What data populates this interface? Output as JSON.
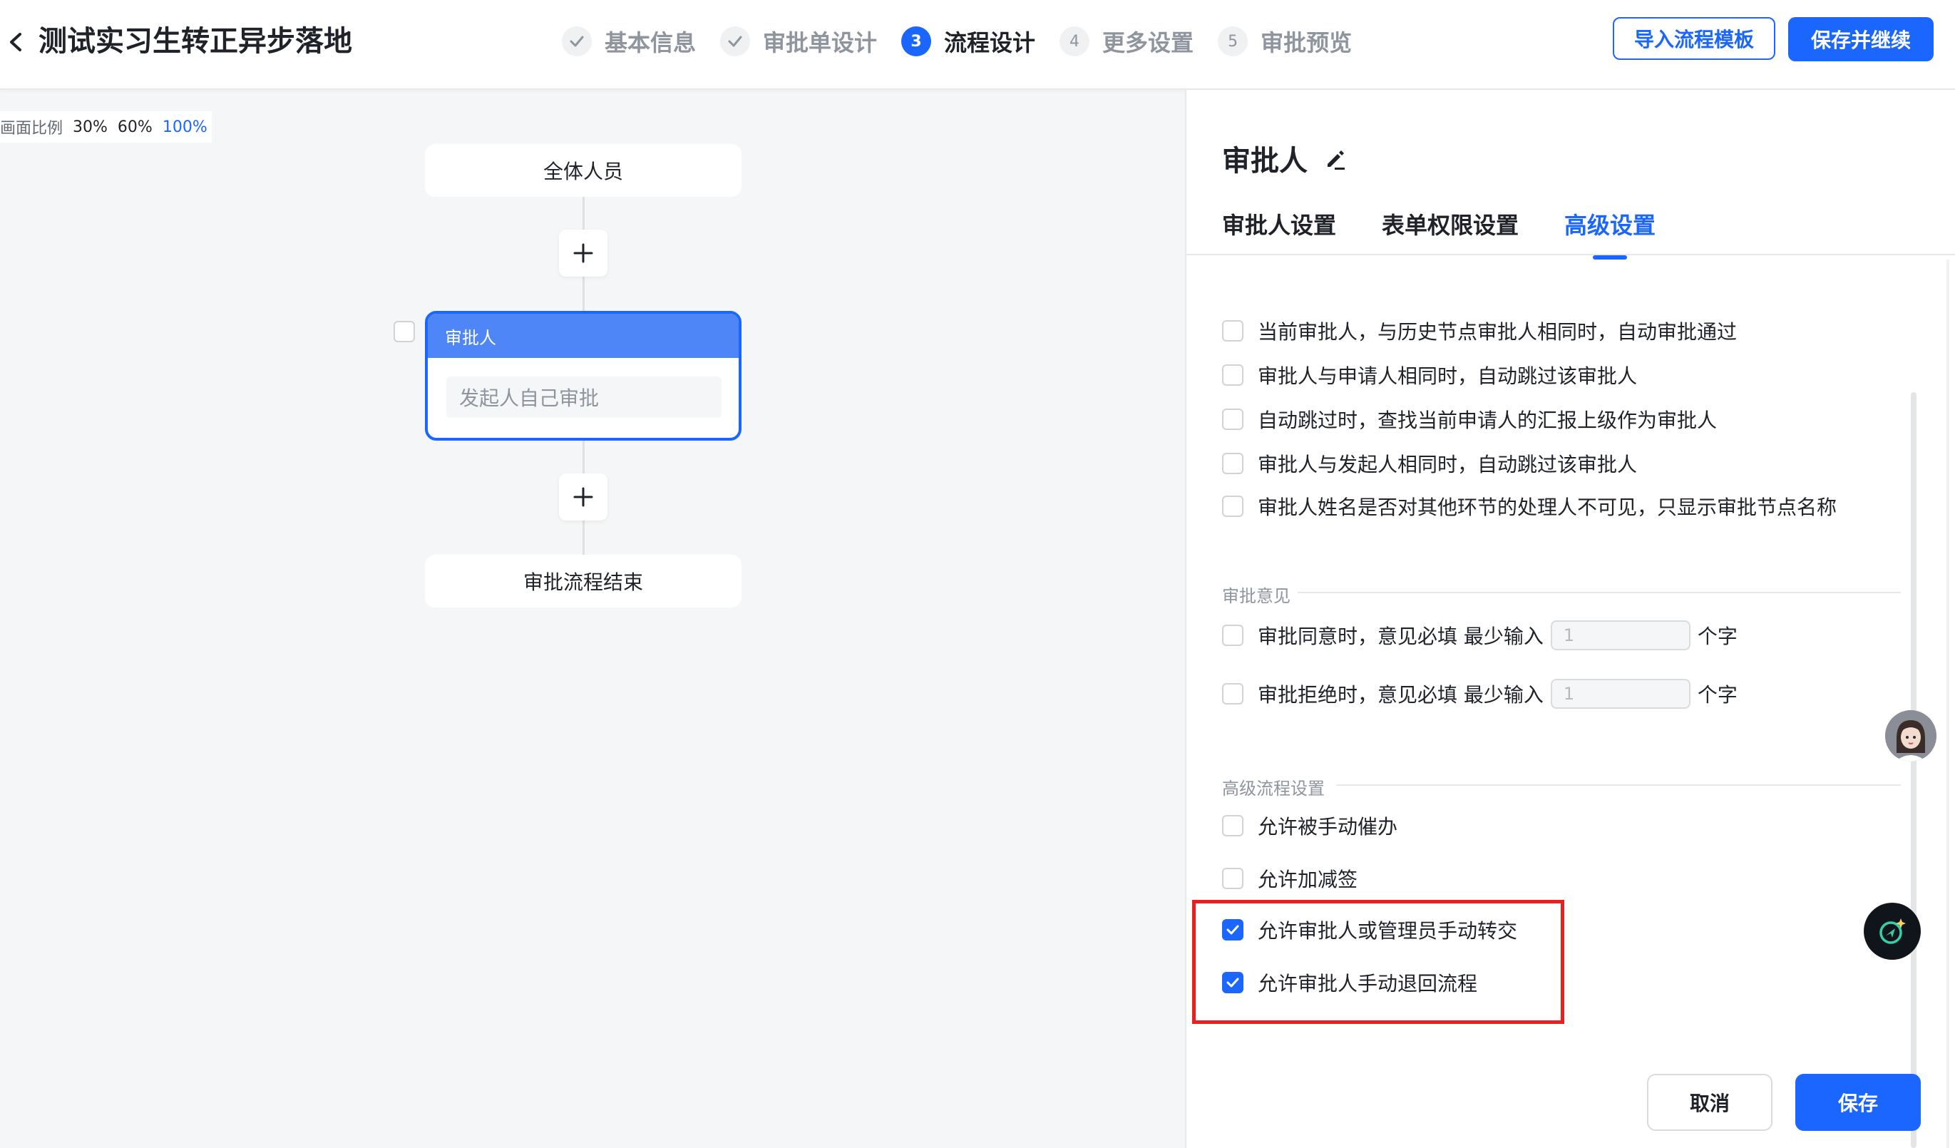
{
  "header": {
    "title": "测试实习生转正异步落地",
    "steps": [
      {
        "num": "",
        "label": "基本信息",
        "state": "done"
      },
      {
        "num": "",
        "label": "审批单设计",
        "state": "done"
      },
      {
        "num": "3",
        "label": "流程设计",
        "state": "active"
      },
      {
        "num": "4",
        "label": "更多设置",
        "state": "pending"
      },
      {
        "num": "5",
        "label": "审批预览",
        "state": "pending"
      }
    ],
    "import_button": "导入流程模板",
    "save_continue_button": "保存并继续"
  },
  "zoom": {
    "label": "画面比例",
    "options": [
      "30%",
      "60%",
      "100%"
    ],
    "selected": "100%"
  },
  "flow": {
    "start_node": "全体人员",
    "approver_node": {
      "title": "审批人",
      "content": "发起人自己审批"
    },
    "end_node": "审批流程结束"
  },
  "panel": {
    "title": "审批人",
    "tabs": [
      "审批人设置",
      "表单权限设置",
      "高级设置"
    ],
    "active_tab": "高级设置",
    "auto_options": [
      {
        "label": "当前审批人，与历史节点审批人相同时，自动审批通过",
        "checked": false
      },
      {
        "label": "审批人与申请人相同时，自动跳过该审批人",
        "checked": false
      },
      {
        "label": "自动跳过时，查找当前申请人的汇报上级作为审批人",
        "checked": false
      },
      {
        "label": "审批人与发起人相同时，自动跳过该审批人",
        "checked": false
      },
      {
        "label": "审批人姓名是否对其他环节的处理人不可见，只显示审批节点名称",
        "checked": false
      }
    ],
    "opinion_section": {
      "label": "审批意见",
      "rows": [
        {
          "label": "审批同意时，意见必填 最少输入",
          "placeholder": "1",
          "unit": "个字",
          "checked": false
        },
        {
          "label": "审批拒绝时，意见必填 最少输入",
          "placeholder": "1",
          "unit": "个字",
          "checked": false
        }
      ]
    },
    "advanced_section": {
      "label": "高级流程设置",
      "options": [
        {
          "label": "允许被手动催办",
          "checked": false
        },
        {
          "label": "允许加减签",
          "checked": false
        },
        {
          "label": "允许审批人或管理员手动转交",
          "checked": true
        },
        {
          "label": "允许审批人手动退回流程",
          "checked": true
        }
      ]
    },
    "cancel_button": "取消",
    "save_button": "保存"
  },
  "colors": {
    "accent": "#1a66ff",
    "highlight": "#e8201e"
  }
}
